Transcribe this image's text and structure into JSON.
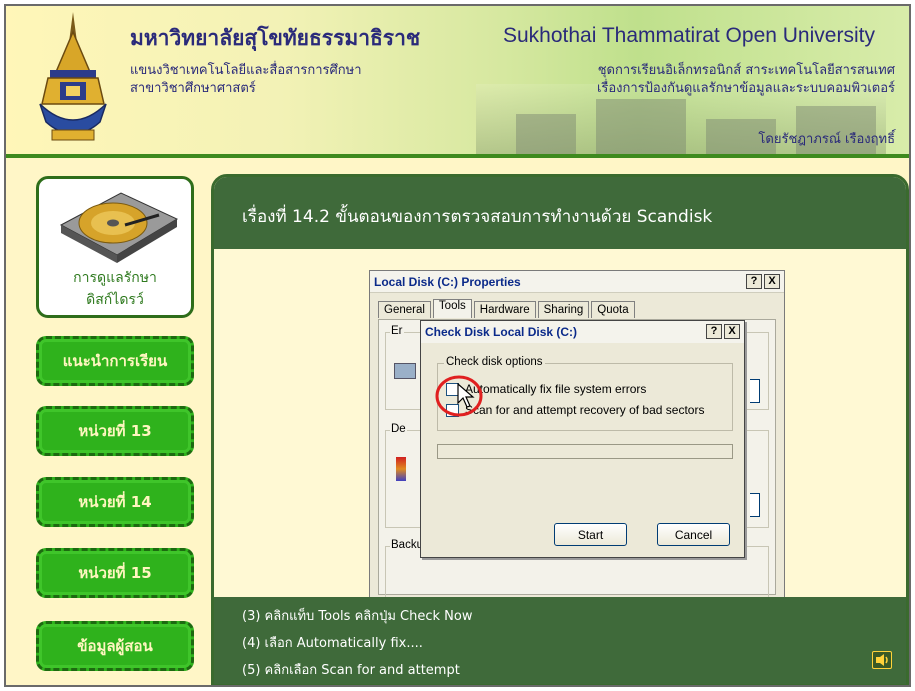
{
  "header": {
    "university_th": "มหาวิทยาลัยสุโขทัยธรรมาธิราช",
    "department_line1": "แขนงวิชาเทคโนโลยีและสื่อสารการศึกษา",
    "department_line2": "สาขาวิชาศึกษาศาสตร์",
    "university_en": "Sukhothai Thammatirat Open University",
    "series_line1": "ชุดการเรียนอิเล็กทรอนิกส์ สาระเทคโนโลยีสารสนเทศ",
    "series_line2": "เรื่องการป้องกันดูแลรักษาข้อมูลและระบบคอมพิวเตอร์",
    "author": "โดยรัชฎาภรณ์ เรืองฤทธิ์"
  },
  "sidebar": {
    "topic_label_line1": "การดูแลรักษา",
    "topic_label_line2": "ดิสก์ไดรว์",
    "items": [
      {
        "label": "แนะนำการเรียน"
      },
      {
        "label": "หน่วยที่ 13"
      },
      {
        "label": "หน่วยที่ 14"
      },
      {
        "label": "หน่วยที่ 15"
      },
      {
        "label": "ข้อมูลผู้สอน"
      }
    ]
  },
  "main": {
    "title": "เรื่องที่ 14.2 ขั้นตอนของการตรวจสอบการทำงานด้วย Scandisk"
  },
  "properties_dialog": {
    "title": "Local Disk (C:) Properties",
    "help_btn": "?",
    "close_btn": "X",
    "tabs": [
      "General",
      "Tools",
      "Hardware",
      "Sharing",
      "Quota"
    ],
    "group_error": "Er",
    "group_defrag": "De",
    "group_backup": "Backup"
  },
  "check_disk_dialog": {
    "title": "Check Disk Local Disk (C:)",
    "help_btn": "?",
    "close_btn": "X",
    "group_label": "Check disk options",
    "option1": "Automatically fix file system errors",
    "option2": "Scan for and attempt recovery of bad sectors",
    "start_label": "Start",
    "cancel_label": "Cancel"
  },
  "instructions": [
    "(3) คลิกแท็บ Tools คลิกปุ่ม Check Now",
    "(4) เลือก Automatically fix....",
    "(5) คลิกเลือก Scan for and attempt"
  ],
  "colors": {
    "header_border": "#3e8a1e",
    "panel_dark": "#3f6a3a",
    "nav_green": "#2fb21c",
    "highlight_circle": "#e02020"
  }
}
